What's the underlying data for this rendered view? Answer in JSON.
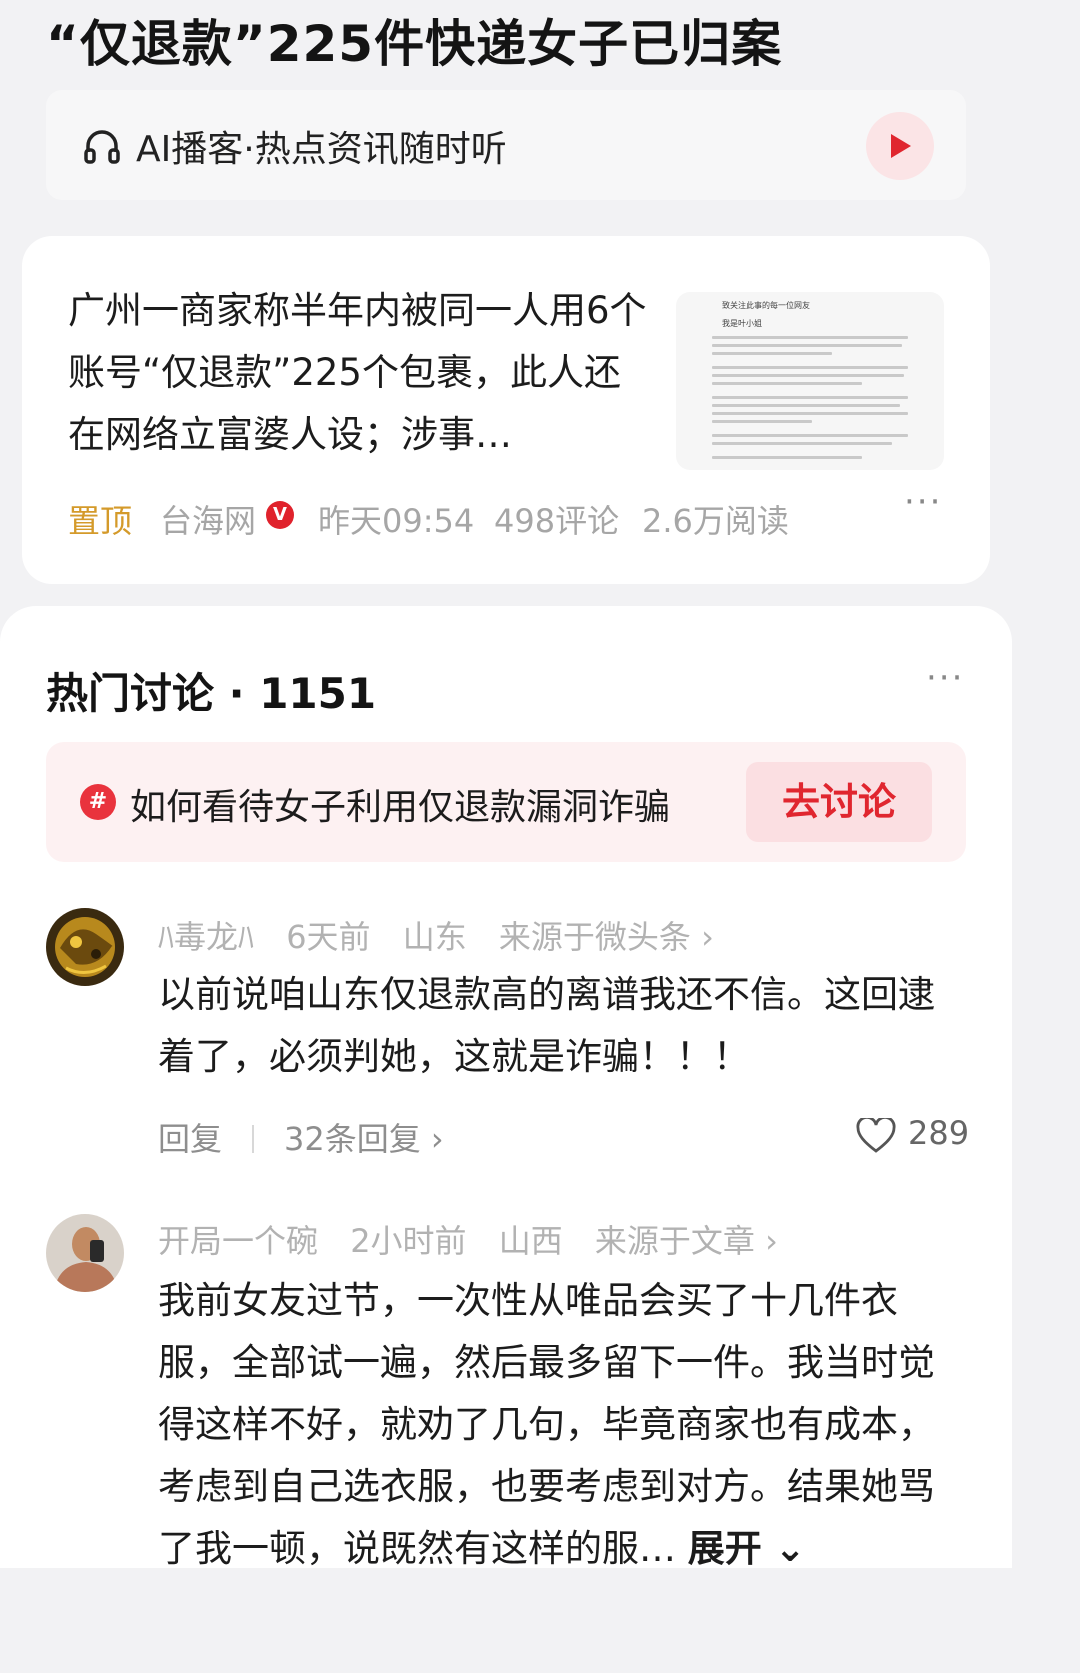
{
  "headline": "“仅退款”225件快递女子已归案",
  "podcast": {
    "icon": "headphones-icon",
    "label": "AI播客·热点资讯随时听",
    "play_icon": "play-icon",
    "accent": "#e0262f"
  },
  "news": {
    "text": "广州一商家称半年内被同一人用6个账号“仅退款”225个包裹，此人还在网络立富婆人设；涉事…",
    "thumbnail": {
      "line1": "致关注此事的每一位网友",
      "line2": "我是叶小姐"
    },
    "pin_label": "置顶",
    "source": "台海网",
    "verified_badge": "V",
    "time": "昨天09:54",
    "comments": "498评论",
    "reads": "2.6万阅读",
    "more": "···"
  },
  "discussion": {
    "title": "热门讨论 · 1151",
    "more": "···",
    "topic": {
      "icon": "#",
      "text": "如何看待女子利用仅退款漏洞诈骗",
      "button": "去讨论"
    },
    "comments": [
      {
        "user": "ﾊ毒龙ﾊ",
        "time": "6天前",
        "location": "山东",
        "source": "来源于微头条 ›",
        "body": "以前说咱山东仅退款高的离谱我还不信。这回逮着了，必须判她，这就是诈骗！！！",
        "reply_label": "回复",
        "replies_label": "32条回复 ›",
        "likes": "289"
      },
      {
        "user": "开局一个碗",
        "time": "2小时前",
        "location": "山西",
        "source": "来源于文章 ›",
        "body": "我前女友过节，一次性从唯品会买了十几件衣服，全部试一遍，然后最多留下一件。我当时觉得这样不好，就劝了几句，毕竟商家也有成本，考虑到自己选衣服，也要考虑到对方。结果她骂了我一顿，说既然有这样的服…",
        "expand_label": "展开 ⌄"
      }
    ]
  }
}
